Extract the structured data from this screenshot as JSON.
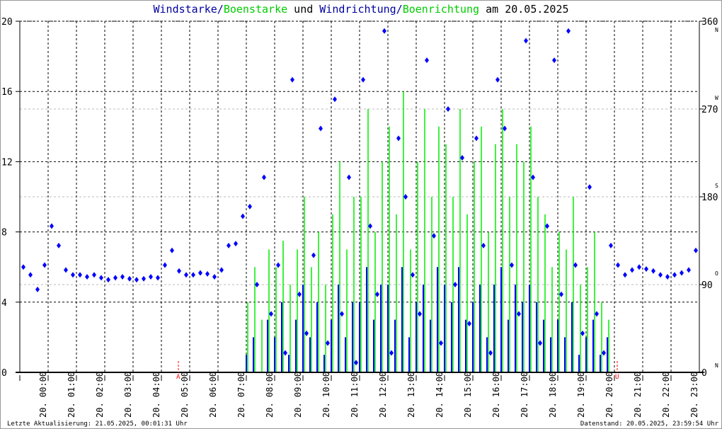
{
  "chart_data": {
    "type": "scatter",
    "title_parts": [
      {
        "text": "Windstarke",
        "color": "#0000a0"
      },
      {
        "text": "/",
        "color": "#0000a0"
      },
      {
        "text": "Boenstarke",
        "color": "#00cc00"
      },
      {
        "text": " und ",
        "color": "#000000"
      },
      {
        "text": "Windrichtung",
        "color": "#0000a0"
      },
      {
        "text": "/",
        "color": "#0000a0"
      },
      {
        "text": "Boenrichtung",
        "color": "#00cc00"
      },
      {
        "text": " am 20.05.2025",
        "color": "#000000"
      }
    ],
    "left_axis": {
      "ylim": [
        0,
        20
      ],
      "ticks": [
        "0",
        "4",
        "8",
        "12",
        "16",
        "20"
      ]
    },
    "right_axis": {
      "ylim": [
        0,
        360
      ],
      "ticks": [
        "0",
        "90",
        "180",
        "270",
        "360"
      ],
      "compass": [
        "N",
        "O",
        "S",
        "W",
        "N"
      ]
    },
    "x_ticks": [
      "20. 00:00",
      "20. 01:00",
      "20. 02:00",
      "20. 03:00",
      "20. 04:00",
      "20. 05:00",
      "20. 06:00",
      "20. 07:00",
      "20. 08:00",
      "20. 09:00",
      "20. 10:00",
      "20. 11:00",
      "20. 12:00",
      "20. 13:00",
      "20. 14:00",
      "20. 15:00",
      "20. 16:00",
      "20. 17:00",
      "20. 18:00",
      "20. 19:00",
      "20. 20:00",
      "20. 21:00",
      "20. 22:00",
      "20. 23:00"
    ],
    "xlim_hours": [
      0,
      24
    ],
    "interval_minutes": 15,
    "markers": [
      {
        "label": "A",
        "hour": 5.6,
        "color": "#ff0000"
      },
      {
        "label": "U",
        "hour": 21.1,
        "color": "#ff0000"
      }
    ],
    "colors": {
      "wind": "#0000ff",
      "gust": "#00ee00"
    },
    "series": [
      {
        "name": "Windstarke",
        "values": [
          0,
          0,
          0,
          0,
          0,
          0,
          0,
          0,
          0,
          0,
          0,
          0,
          0,
          0,
          0,
          0,
          0,
          0,
          0,
          0,
          0,
          0,
          0,
          0,
          0,
          0,
          0,
          0,
          0,
          0,
          0,
          0,
          1,
          2,
          0,
          3,
          2,
          4,
          1,
          3,
          5,
          2,
          4,
          1,
          3,
          5,
          2,
          4,
          4,
          6,
          3,
          5,
          5,
          3,
          6,
          2,
          4,
          5,
          3,
          6,
          5,
          4,
          6,
          3,
          4,
          5,
          2,
          5,
          6,
          3,
          5,
          4,
          5,
          4,
          3,
          2,
          3,
          2,
          4,
          1,
          2,
          3,
          1,
          2,
          0,
          0,
          0,
          0,
          0,
          0,
          0,
          0,
          0,
          0,
          0,
          0
        ]
      },
      {
        "name": "Boenstarke",
        "values": [
          0,
          0,
          0,
          0,
          0,
          0,
          0,
          0,
          0,
          0,
          0,
          0,
          0,
          0,
          0,
          0,
          0,
          0,
          0,
          0,
          0,
          0,
          0,
          0,
          0,
          0,
          0,
          0,
          0,
          0,
          0,
          0,
          4,
          6,
          3,
          7,
          6,
          7.5,
          5,
          7,
          10,
          6,
          8,
          5,
          9,
          12,
          7,
          10,
          10,
          15,
          8,
          12,
          14,
          9,
          16,
          7,
          12,
          15,
          10,
          14,
          13,
          10,
          15,
          9,
          12,
          14,
          8,
          13,
          15,
          10,
          13,
          12,
          14,
          10,
          9,
          6,
          8,
          7,
          10,
          5,
          6,
          8,
          4,
          3,
          0,
          0,
          0,
          0,
          0,
          0,
          0,
          0,
          0,
          0,
          0,
          0
        ]
      },
      {
        "name": "Windrichtung",
        "values": [
          108,
          100,
          85,
          110,
          150,
          130,
          105,
          100,
          100,
          98,
          100,
          97,
          95,
          97,
          98,
          96,
          95,
          96,
          98,
          97,
          110,
          125,
          104,
          100,
          100,
          102,
          101,
          98,
          105,
          130,
          132,
          160,
          170,
          90,
          200,
          60,
          110,
          20,
          300,
          80,
          40,
          120,
          250,
          30,
          280,
          60,
          200,
          10,
          300,
          150,
          80,
          350,
          20,
          240,
          180,
          100,
          60,
          320,
          140,
          30,
          270,
          90,
          220,
          50,
          240,
          130,
          20,
          300,
          250,
          110,
          60,
          340,
          200,
          30,
          150,
          320,
          80,
          350,
          110,
          40,
          190,
          60,
          20,
          130,
          110,
          100,
          105,
          108,
          106,
          104,
          100,
          98,
          100,
          102,
          105,
          125
        ]
      }
    ]
  },
  "footer": {
    "left": "Letzte Aktualisierung: 21.05.2025, 00:01:31 Uhr",
    "right": "Datenstand: 20.05.2025, 23:59:54 Uhr"
  }
}
